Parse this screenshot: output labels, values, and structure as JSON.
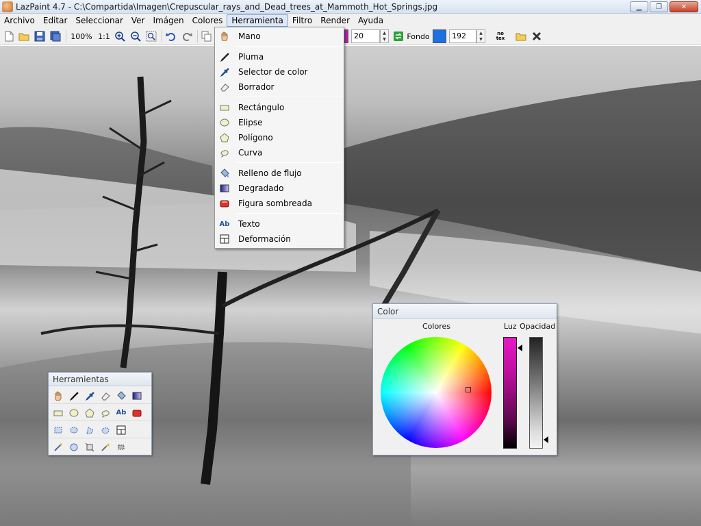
{
  "window": {
    "title": "LazPaint 4.7 - C:\\Compartida\\Imagen\\Crepuscular_rays_and_Dead_trees_at_Mammoth_Hot_Springs.jpg",
    "minimize_glyph": "▁",
    "maximize_glyph": "❐",
    "close_glyph": "✕"
  },
  "menubar": {
    "items": [
      "Archivo",
      "Editar",
      "Seleccionar",
      "Ver",
      "Imágen",
      "Colores",
      "Herramienta",
      "Filtro",
      "Render",
      "Ayuda"
    ],
    "active": "Herramienta"
  },
  "toolbar": {
    "zoom": "100%",
    "ratio": "1:1",
    "pen_width": "20",
    "fondo_label": "Fondo",
    "fondo_color": "#1e6fe0",
    "fondo_alpha": "192",
    "pen_color": "#c11fb0",
    "notex_label": "no tex"
  },
  "herramienta_menu": {
    "items": [
      {
        "label": "Mano",
        "icon": "hand-icon"
      },
      {
        "label": "Pluma",
        "icon": "pen-icon"
      },
      {
        "label": "Selector de color",
        "icon": "color-picker-icon"
      },
      {
        "label": "Borrador",
        "icon": "eraser-icon"
      },
      {
        "label": "Rectángulo",
        "icon": "rectangle-icon"
      },
      {
        "label": "Elipse",
        "icon": "ellipse-icon"
      },
      {
        "label": "Polígono",
        "icon": "polygon-icon"
      },
      {
        "label": "Curva",
        "icon": "curve-icon"
      },
      {
        "label": "Relleno de flujo",
        "icon": "flood-fill-icon"
      },
      {
        "label": "Degradado",
        "icon": "gradient-icon"
      },
      {
        "label": "Figura sombreada",
        "icon": "shaded-shape-icon"
      },
      {
        "label": "Texto",
        "icon": "text-icon"
      },
      {
        "label": "Deformación",
        "icon": "deformation-icon"
      }
    ],
    "text_icon_glyph": "Ab"
  },
  "color_panel": {
    "title": "Color",
    "colores_label": "Colores",
    "luz_label": "Luz",
    "opacidad_label": "Opacidad",
    "luz_level": 0.1,
    "opacidad_level": 0.92
  },
  "tools_panel": {
    "title": "Herramientas",
    "text_glyph": "Ab"
  }
}
